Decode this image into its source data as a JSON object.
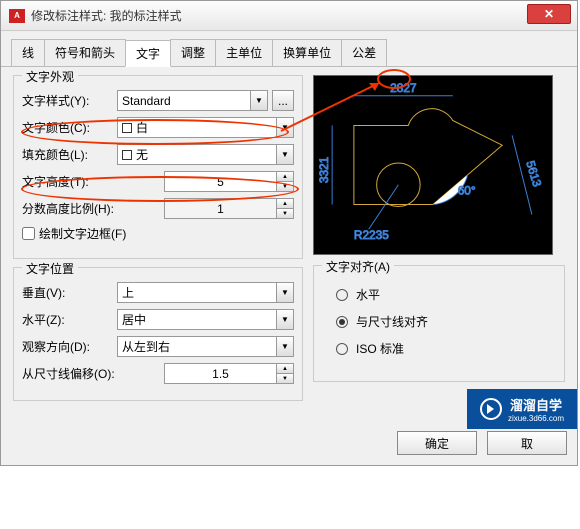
{
  "window": {
    "title": "修改标注样式: 我的标注样式"
  },
  "tabs": [
    "线",
    "符号和箭头",
    "文字",
    "调整",
    "主单位",
    "换算单位",
    "公差"
  ],
  "active_tab": 2,
  "appearance": {
    "group_title": "文字外观",
    "style_label": "文字样式(Y):",
    "style_value": "Standard",
    "color_label": "文字颜色(C):",
    "color_value": "白",
    "fill_label": "填充颜色(L):",
    "fill_value": "无",
    "height_label": "文字高度(T):",
    "height_value": "5",
    "fraction_label": "分数高度比例(H):",
    "fraction_value": "1",
    "frame_label": "绘制文字边框(F)"
  },
  "position": {
    "group_title": "文字位置",
    "vertical_label": "垂直(V):",
    "vertical_value": "上",
    "horizontal_label": "水平(Z):",
    "horizontal_value": "居中",
    "viewdir_label": "观察方向(D):",
    "viewdir_value": "从左到右",
    "offset_label": "从尺寸线偏移(O):",
    "offset_value": "1.5"
  },
  "align": {
    "group_title": "文字对齐(A)",
    "opt1": "水平",
    "opt2": "与尺寸线对齐",
    "opt3": "ISO 标准",
    "selected": 1
  },
  "preview": {
    "dim_top": "2827",
    "dim_left": "3321",
    "dim_right": "5613",
    "dim_angle": "60°",
    "dim_radius": "R2235"
  },
  "footer": {
    "ok": "确定",
    "cancel": "取"
  },
  "watermark": {
    "line1": "溜溜自学",
    "line2": "zixue.3d66.com"
  }
}
